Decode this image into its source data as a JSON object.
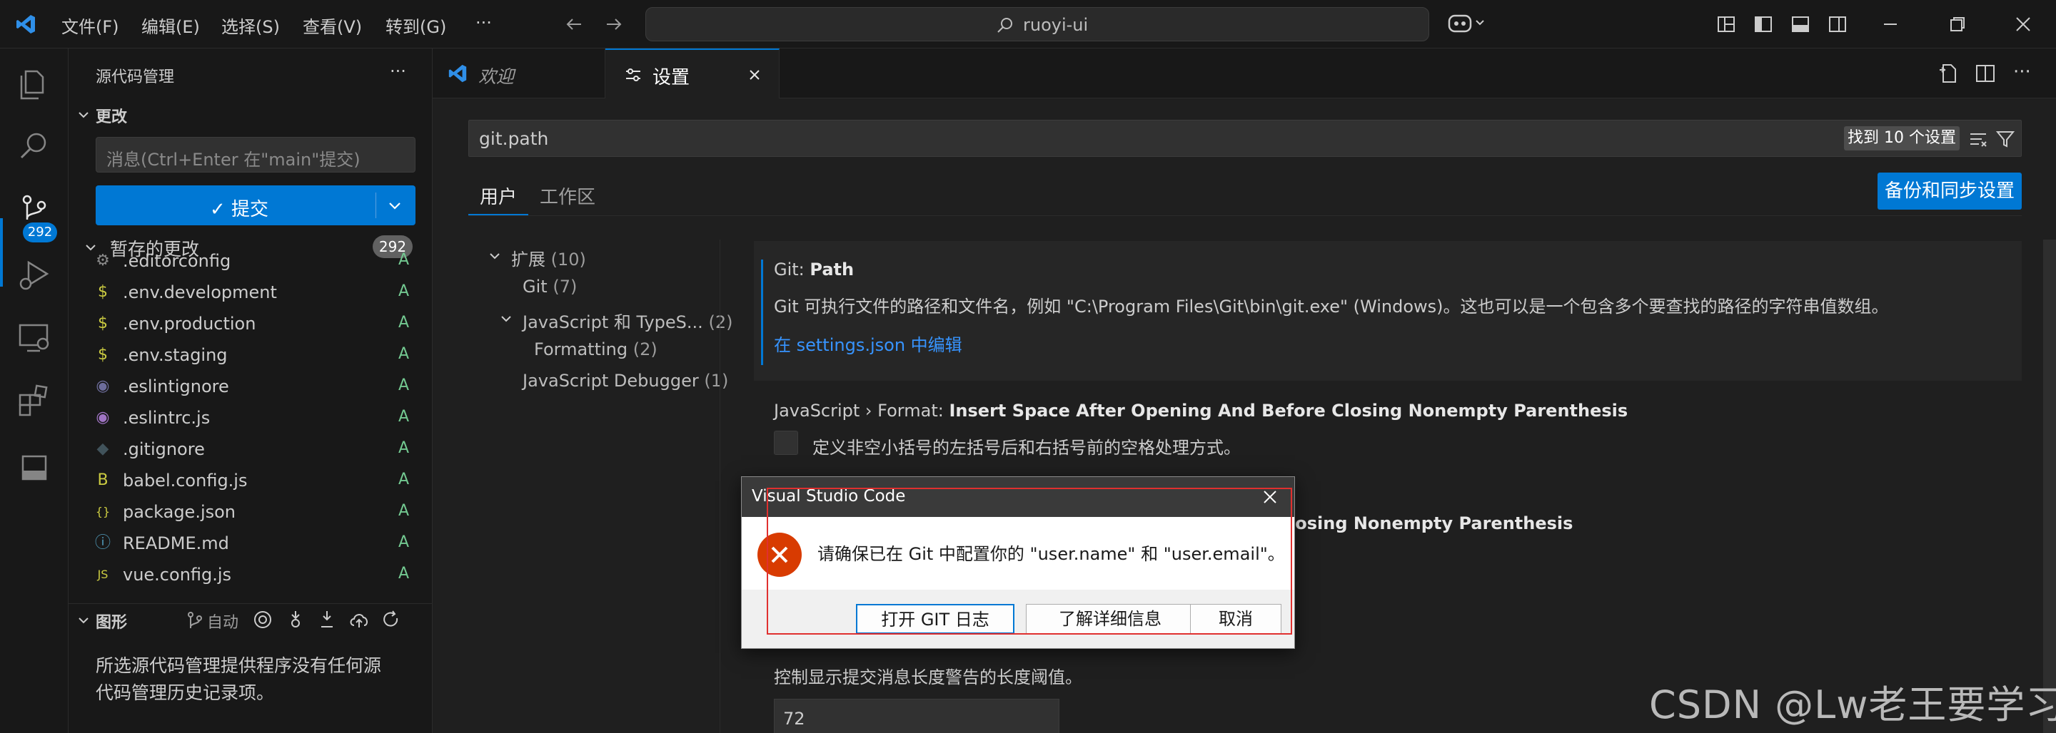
{
  "titlebar": {
    "menu": [
      "文件(F)",
      "编辑(E)",
      "选择(S)",
      "查看(V)",
      "转到(G)",
      "···"
    ],
    "search_text": "ruoyi-ui"
  },
  "activity": {
    "badge_count": "292"
  },
  "sidebar": {
    "title": "源代码管理",
    "more": "···",
    "changes_section": "更改",
    "commit_placeholder": "消息(Ctrl+Enter 在\"main\"提交)",
    "commit_button": "✓ 提交",
    "staged_section": "暂存的更改",
    "staged_count": "292",
    "files": [
      {
        "name": ".editorconfig",
        "status": "A",
        "icon": "gear-icon",
        "glyph": "⚙",
        "color": "#8a8a8a"
      },
      {
        "name": ".env.development",
        "status": "A",
        "icon": "dollar-icon",
        "glyph": "$",
        "color": "#cbcb41"
      },
      {
        "name": ".env.production",
        "status": "A",
        "icon": "dollar-icon",
        "glyph": "$",
        "color": "#cbcb41"
      },
      {
        "name": ".env.staging",
        "status": "A",
        "icon": "dollar-icon",
        "glyph": "$",
        "color": "#cbcb41"
      },
      {
        "name": ".eslintignore",
        "status": "A",
        "icon": "eslint-icon",
        "glyph": "◉",
        "color": "#6d6d9c"
      },
      {
        "name": ".eslintrc.js",
        "status": "A",
        "icon": "eslint-icon",
        "glyph": "◉",
        "color": "#a074c4"
      },
      {
        "name": ".gitignore",
        "status": "A",
        "icon": "git-icon",
        "glyph": "◆",
        "color": "#41535b"
      },
      {
        "name": "babel.config.js",
        "status": "A",
        "icon": "babel-icon",
        "glyph": "B",
        "color": "#cbcb41"
      },
      {
        "name": "package.json",
        "status": "A",
        "icon": "json-icon",
        "glyph": "{}",
        "color": "#cbcb41"
      },
      {
        "name": "README.md",
        "status": "A",
        "icon": "info-icon",
        "glyph": "ⓘ",
        "color": "#519aba"
      },
      {
        "name": "vue.config.js",
        "status": "A",
        "icon": "js-icon",
        "glyph": "JS",
        "color": "#cbcb41"
      }
    ],
    "graph_section": "图形",
    "graph_auto": "自动",
    "empty_message_line1": "所选源代码管理提供程序没有任何源",
    "empty_message_line2": "代码管理历史记录项。"
  },
  "tabs": [
    {
      "label": "欢迎"
    },
    {
      "label": "设置"
    }
  ],
  "settings": {
    "search_value": "git.path",
    "found_label": "找到 10 个设置",
    "backup_button": "备份和同步设置",
    "scope_tabs": [
      "用户",
      "工作区"
    ],
    "toc": [
      {
        "label": "扩展",
        "count": "(10)"
      },
      {
        "label": "Git",
        "count": "(7)"
      },
      {
        "label": "JavaScript 和 TypeS...",
        "count": "(2)"
      },
      {
        "label": "Formatting",
        "count": "(2)"
      },
      {
        "label": "JavaScript Debugger",
        "count": "(1)"
      }
    ],
    "git_path_category": "Git: ",
    "git_path_name": "Path",
    "git_path_desc": "Git 可执行文件的路径和文件名，例如 \"C:\\Program Files\\Git\\bin\\git.exe\" (Windows)。这也可以是一个包含多个要查找的路径的字符串值数组。",
    "git_path_link": "在 settings.json 中编辑",
    "js_setting_category": "JavaScript › Format: ",
    "js_setting_name": "Insert Space After Opening And Before Closing Nonempty Parenthesis",
    "js_setting_desc": "定义非空小括号的左括号后和右括号前的空格处理方式。",
    "ts_setting_partial": "losing Nonempty Parenthesis",
    "commit_len_desc": "控制显示提交消息长度警告的长度阈值。",
    "commit_len_value": "72"
  },
  "dialog": {
    "title": "Visual Studio Code",
    "message": "请确保已在 Git 中配置你的 \"user.name\" 和 \"user.email\"。",
    "buttons": [
      "打开 GIT 日志",
      "了解详细信息",
      "取消"
    ]
  },
  "watermark": "CSDN @Lw老王要学习"
}
